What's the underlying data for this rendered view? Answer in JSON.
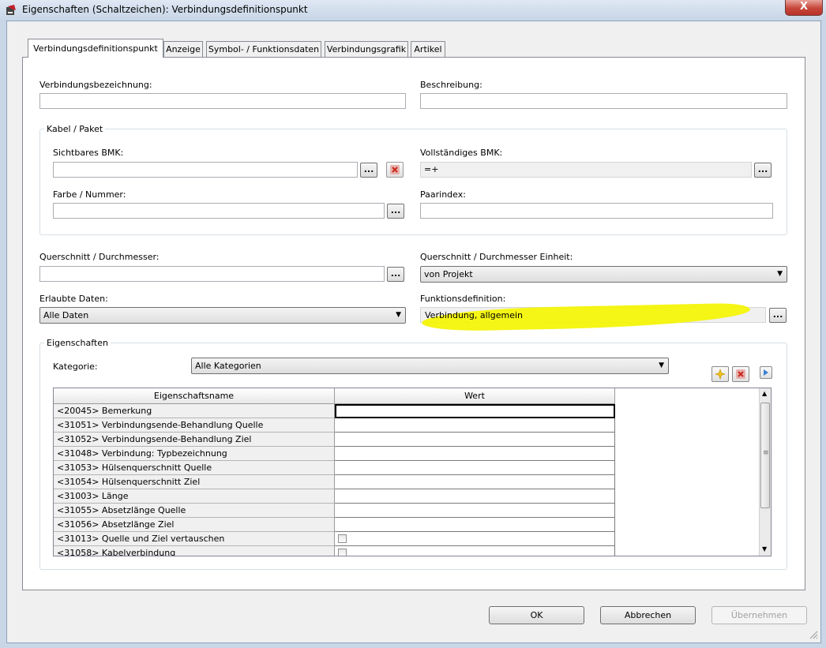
{
  "window": {
    "title": "Eigenschaften (Schaltzeichen): Verbindungsdefinitionspunkt",
    "close_label": "X"
  },
  "tabs": [
    {
      "label": "Verbindungsdefinitionspunkt",
      "active": true
    },
    {
      "label": "Anzeige"
    },
    {
      "label": "Symbol- / Funktionsdaten"
    },
    {
      "label": "Verbindungsgrafik"
    },
    {
      "label": "Artikel"
    }
  ],
  "form": {
    "verbindungsbezeichnung_label": "Verbindungsbezeichnung:",
    "verbindungsbezeichnung_value": "",
    "beschreibung_label": "Beschreibung:",
    "beschreibung_value": "",
    "kabel_group_label": "Kabel / Paket",
    "sichtbares_bmk_label": "Sichtbares BMK:",
    "sichtbares_bmk_value": "",
    "vollstaendiges_bmk_label": "Vollständiges BMK:",
    "vollstaendiges_bmk_value": "=+",
    "farbe_label": "Farbe / Nummer:",
    "farbe_value": "",
    "paarindex_label": "Paarindex:",
    "paarindex_value": "",
    "querschnitt_label": "Querschnitt / Durchmesser:",
    "querschnitt_value": "",
    "querschnitt_einheit_label": "Querschnitt / Durchmesser Einheit:",
    "querschnitt_einheit_value": "von Projekt",
    "erlaubte_daten_label": "Erlaubte Daten:",
    "erlaubte_daten_value": "Alle Daten",
    "funktionsdefinition_label": "Funktionsdefinition:",
    "funktionsdefinition_value": "Verbindung, allgemein",
    "dots_label": "...",
    "highlight_color": "#f4f40a"
  },
  "properties": {
    "group_label": "Eigenschaften",
    "kategorie_label": "Kategorie:",
    "kategorie_value": "Alle Kategorien",
    "columns": [
      "Eigenschaftsname",
      "Wert"
    ],
    "rows": [
      {
        "name": "<20045> Bemerkung",
        "type": "text",
        "selected": true
      },
      {
        "name": "<31051> Verbindungsende-Behandlung Quelle",
        "type": "text"
      },
      {
        "name": "<31052> Verbindungsende-Behandlung Ziel",
        "type": "text"
      },
      {
        "name": "<31048> Verbindung: Typbezeichnung",
        "type": "text"
      },
      {
        "name": "<31053> Hülsenquerschnitt Quelle",
        "type": "text"
      },
      {
        "name": "<31054> Hülsenquerschnitt Ziel",
        "type": "text"
      },
      {
        "name": "<31003> Länge",
        "type": "text"
      },
      {
        "name": "<31055> Absetzlänge Quelle",
        "type": "text"
      },
      {
        "name": "<31056> Absetzlänge Ziel",
        "type": "text"
      },
      {
        "name": "<31013> Quelle und Ziel vertauschen",
        "type": "checkbox"
      },
      {
        "name": "<31058> Kabelverbindung",
        "type": "checkbox"
      }
    ]
  },
  "buttons": {
    "ok": "OK",
    "cancel": "Abbrechen",
    "apply": "Übernehmen"
  }
}
